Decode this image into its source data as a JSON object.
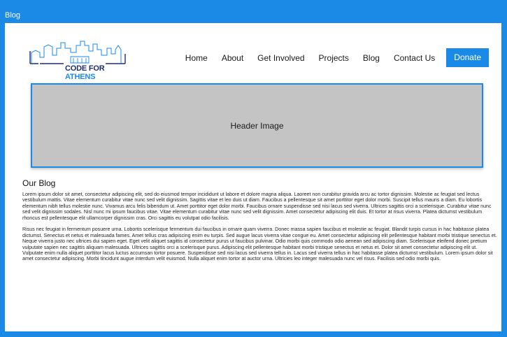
{
  "window": {
    "title": "Blog"
  },
  "logo": {
    "text_part1": "CODE FOR ",
    "text_part2": "ATHENS",
    "color_primary": "#1f2e6b",
    "color_accent": "#1a8ae6"
  },
  "nav": {
    "items": [
      "Home",
      "About",
      "Get Involved",
      "Projects",
      "Blog",
      "Contact Us"
    ],
    "donate": "Donate"
  },
  "hero": {
    "label": "Header Image"
  },
  "blog": {
    "title": "Our Blog",
    "paragraphs": [
      "Lorem ipsum dolor sit amet, consectetur adipiscing elit, sed do eiusmod tempor incididunt ut labore et dolore magna aliqua. Laoreet non curabitur gravida arcu ac tortor dignissim. Molestie ac feugiat sed lectus vestibulum mattis. Vitae elementum curabitur vitae nunc sed velit dignissim. Sagittis vitae et leo duis ut diam. Faucibus a pellentesque sit amet porttitor eget dolor morbi. Suscipit tellus mauris a diam. Eu lobortis elementum nibh tellus molestie nunc. Vivamus arcu felis bibendum ut. Amet porttitor eget dolor morbi. Faucibus ornare suspendisse sed nisi lacus sed viverra. Ultrices sagittis orci a scelerisque. Curabitur vitae nunc sed velit dignissim sodales. Nisl nunc mi ipsum faucibus vitae. Vitae elementum curabitur vitae nunc sed velit dignissim. Amet consectetur adipiscing elit duis. Et tortor at risus viverra. Platea dictumst vestibulum rhoncus est pellentesque elit ullamcorper dignissim cras. Orci sagittis eu volutpat odio facilisis.",
      "Risus nec feugiat in fermentum posuere urna. Lobortis scelerisque fermentum dui faucibus in ornare quam viverra. Donec massa sapien faucibus et molestie ac feugiat. Blandit turpis cursus in hac habitasse platea dictumst. Senectus et netus et malesuada fames. Amet tellus cras adipiscing enim eu turpis. Sed augue lacus viverra vitae congue eu. Amet consectetur adipiscing elit pellentesque habitant morbi tristique senectus et. Neque viverra justo nec ultrices dui sapien eget. Eget velit aliquet sagittis id consectetur purus ut faucibus pulvinar. Odio morbi quis commodo odio aenean sed adipiscing diam. Scelerisque eleifend donec pretium vulputate sapien nec sagittis aliquam malesuada. Ultrices sagittis orci a scelerisque purus. Adipiscing elit pellentesque habitant morbi tristique senectus et netus et. Dolor sit amet consectetur adipiscing elit ut. Vulputate enim nulla aliquet porttitor lacus luctus accumsan tortor posuere. Suspendisse sed nisi lacus sed viverra tellus in. Lacus sed viverra tellus in hac habitasse platea dictumst vestibulum. Lorem ipsum dolor sit amet consectetur adipiscing. Morbi tincidunt augue interdum velit euismod. Nulla aliquet enim tortor at auctor urna. Ultricies leo integer malesuada nunc vel risus. Facilisis sed odio morbi quis."
    ]
  },
  "colors": {
    "frame": "#1a8ae6",
    "hero_fill": "#c4c4c4",
    "donate_bg": "#1a8ae6"
  }
}
